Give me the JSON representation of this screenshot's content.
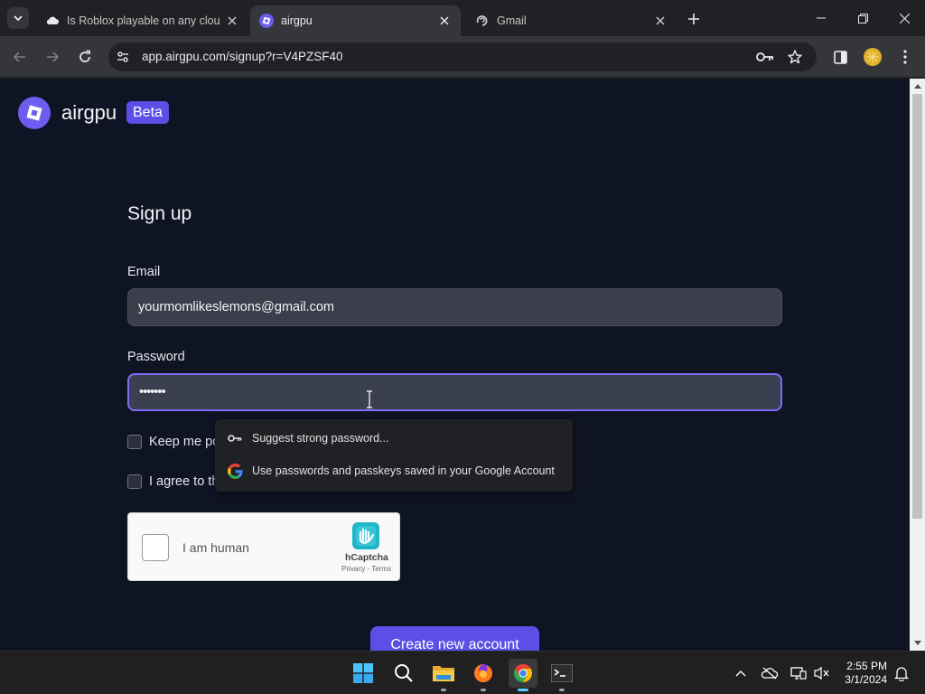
{
  "browser": {
    "tabs": [
      {
        "title": "Is Roblox playable on any cloud",
        "icon": "cloud-icon",
        "active": false
      },
      {
        "title": "airgpu",
        "icon": "airgpu-favicon",
        "active": true
      },
      {
        "title": "Gmail",
        "icon": "loading-icon",
        "active": false
      }
    ],
    "url": "app.airgpu.com/signup?r=V4PZSF40"
  },
  "page": {
    "brand": "airgpu",
    "badge": "Beta",
    "title": "Sign up",
    "email_label": "Email",
    "email_value": "yourmomlikeslemons@gmail.com",
    "password_label": "Password",
    "password_value": "•••••••",
    "keep_logged_in": "Keep me po",
    "agree_terms": "I agree to th",
    "submit": "Create new account"
  },
  "autofill": {
    "items": [
      {
        "label": "Suggest strong password...",
        "icon": "key-icon"
      },
      {
        "label": "Use passwords and passkeys saved in your Google Account",
        "icon": "google-icon"
      }
    ]
  },
  "captcha": {
    "label": "I am human",
    "brand": "hCaptcha",
    "links": "Privacy - Terms"
  },
  "taskbar": {
    "time": "2:55 PM",
    "date": "3/1/2024"
  },
  "colors": {
    "accent": "#5b4fe6",
    "page_bg": "#0f1424",
    "field_bg": "#3a3f4b"
  }
}
